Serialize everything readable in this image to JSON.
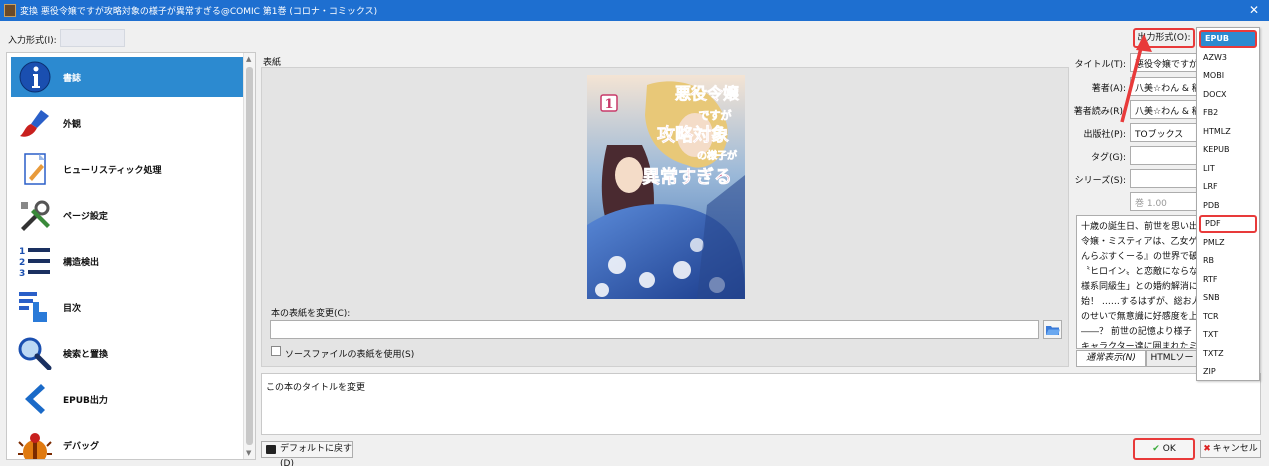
{
  "window": {
    "title": "変換 悪役令嬢ですが攻略対象の様子が異常すぎる@COMIC 第1巻 (コロナ・コミックス)",
    "close_glyph": "✕"
  },
  "input_format": {
    "label": "入力形式(I):"
  },
  "output_format": {
    "label": "出力形式(O):",
    "options": [
      "EPUB",
      "AZW3",
      "MOBI",
      "DOCX",
      "FB2",
      "HTMLZ",
      "KEPUB",
      "LIT",
      "LRF",
      "PDB",
      "PDF",
      "PMLZ",
      "RB",
      "RTF",
      "SNB",
      "TCR",
      "TXT",
      "TXTZ",
      "ZIP"
    ],
    "selected": "EPUB",
    "highlighted": [
      "EPUB",
      "PDF"
    ]
  },
  "sidebar": {
    "items": [
      {
        "label": "書誌",
        "icon": "info-icon",
        "selected": true
      },
      {
        "label": "外観",
        "icon": "paintbrush-icon",
        "selected": false
      },
      {
        "label": "ヒューリスティック処理",
        "icon": "document-pencil-icon",
        "selected": false
      },
      {
        "label": "ページ設定",
        "icon": "tools-icon",
        "selected": false
      },
      {
        "label": "構造検出",
        "icon": "numbered-list-icon",
        "selected": false
      },
      {
        "label": "目次",
        "icon": "toc-pointer-icon",
        "selected": false
      },
      {
        "label": "検索と置換",
        "icon": "magnifier-icon",
        "selected": false
      },
      {
        "label": "EPUB出力",
        "icon": "chevron-left-icon",
        "selected": false
      },
      {
        "label": "デバッグ",
        "icon": "bug-icon",
        "selected": false
      }
    ]
  },
  "cover": {
    "group_label": "表紙",
    "change_label": "本の表紙を変更(C):",
    "path_value": "",
    "use_source_label": "ソースファイルの表紙を使用(S)",
    "use_source_checked": false,
    "image": {
      "volume_badge": "1",
      "title_lines": [
        "悪役令嬢",
        "ですが",
        "攻略対象",
        "の様子が",
        "異常すぎる"
      ]
    }
  },
  "metadata": {
    "title_label": "タイトル(T):",
    "title_value": "悪役令嬢ですが攻",
    "author_label": "著者(A):",
    "author_value": "八美☆わん & 稲",
    "author_sort_label": "著者読み(R):",
    "author_sort_value": "八美☆わん & 稲",
    "publisher_label": "出版社(P):",
    "publisher_value": "TOブックス",
    "tags_label": "タグ(G):",
    "tags_value": "",
    "series_label": "シリーズ(S):",
    "series_value": "",
    "series_index": "巻 1.00"
  },
  "description": {
    "lines": [
      "十歳の誕生日、前世を思い出",
      "令嬢・ミスティアは、乙女ゲー",
      "んらぶすくーる』の世界で破滅",
      "〝ヒロイン〟と恋敵にならない",
      "様系同級生」との婚約解消に",
      "始！ ……するはずが、総お人",
      "のせいで無意識に好感度を上",
      "――？ 前世の記憶より様子",
      "キャラクター達に囲まれたミス"
    ],
    "tabs": [
      {
        "label": "通常表示(N)",
        "active": true
      },
      {
        "label": "HTMLソー",
        "active": false
      }
    ]
  },
  "help_text": "この本のタイトルを変更",
  "footer": {
    "defaults_label": "デフォルトに戻す(D)",
    "ok_label": "OK",
    "cancel_label": "キャンセル"
  },
  "colors": {
    "titlebar": "#1e6fd0",
    "selection": "#2c8ad0",
    "highlight": "#e83a3a"
  }
}
